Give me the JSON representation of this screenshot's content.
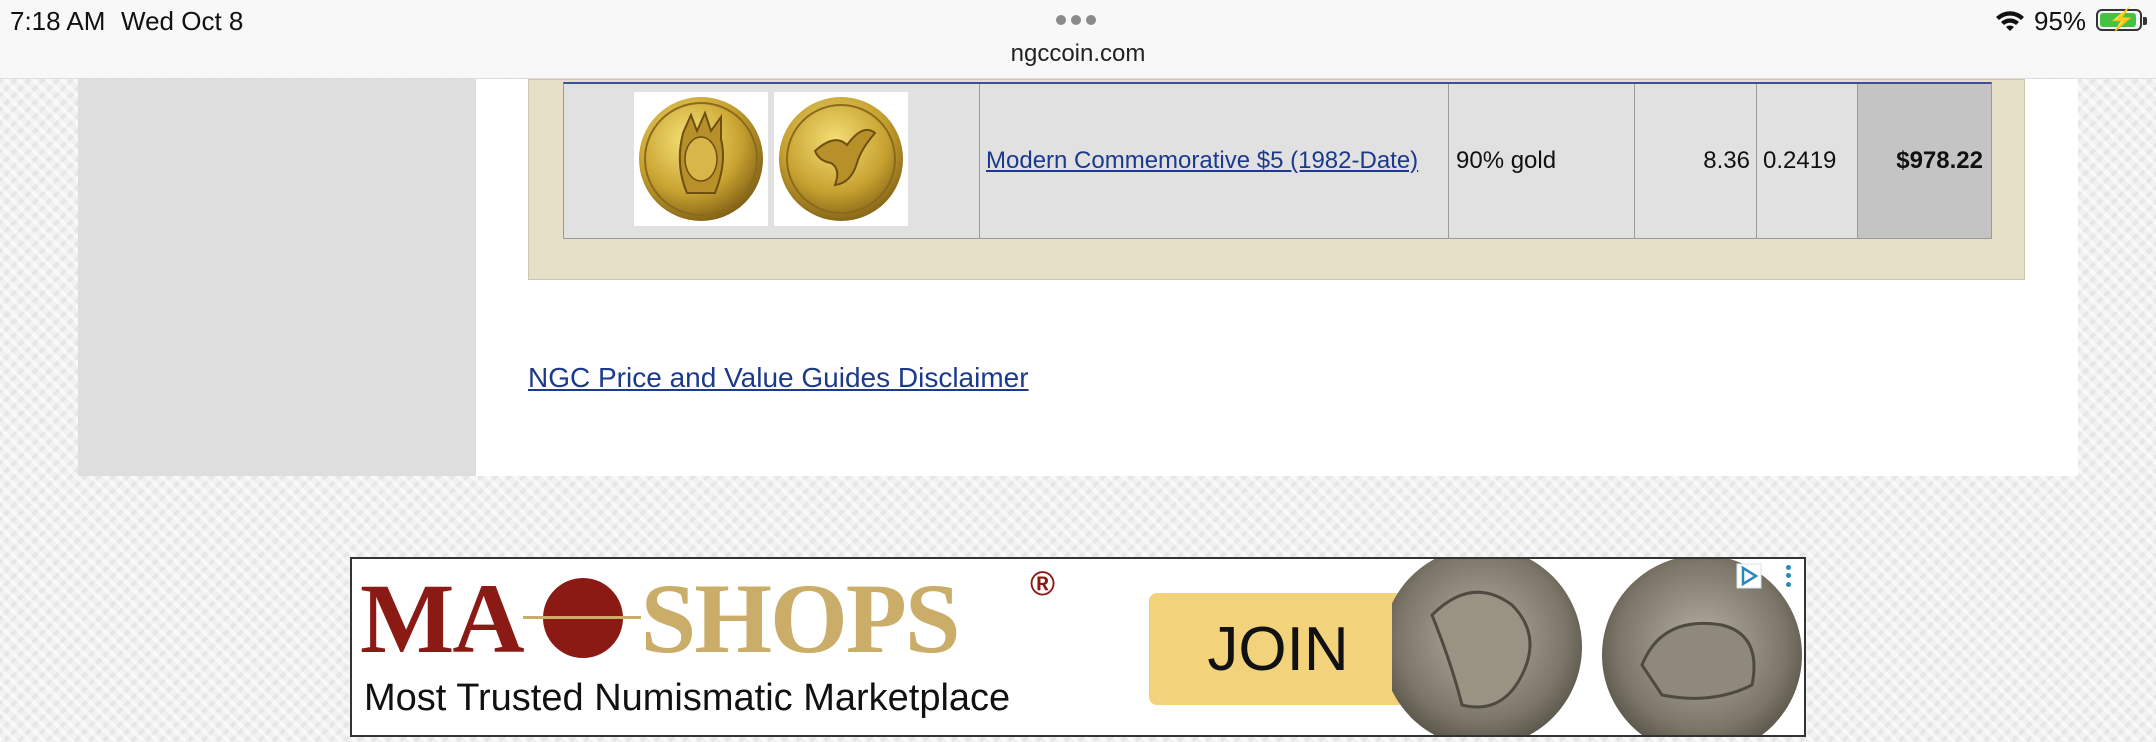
{
  "status_bar": {
    "time": "7:18 AM",
    "date": "Wed Oct 8",
    "url": "ngccoin.com",
    "battery": "95%"
  },
  "price_table": {
    "row": {
      "coin_images": [
        "coin-obverse-liberty",
        "coin-reverse-eagle"
      ],
      "description": "Modern Commemorative $5 (1982-Date)",
      "composition": "90% gold",
      "weight": "8.36",
      "actual_content": "0.2419",
      "value": "$978.22"
    }
  },
  "disclaimer_link": "NGC Price and Value Guides Disclaimer",
  "ad": {
    "logo_left": "MA",
    "logo_right": "SHOPS",
    "registered": "®",
    "tagline": "Most Trusted Numismatic Marketplace",
    "cta": "JOIN",
    "colors": {
      "brand_red": "#8b1a14",
      "brand_gold": "#c9ad68",
      "cta_bg": "#f2d27a"
    }
  },
  "colors": {
    "link": "#1b3a8c",
    "table_bg": "#e1e1e1",
    "table_frame": "#e6e0c8"
  }
}
